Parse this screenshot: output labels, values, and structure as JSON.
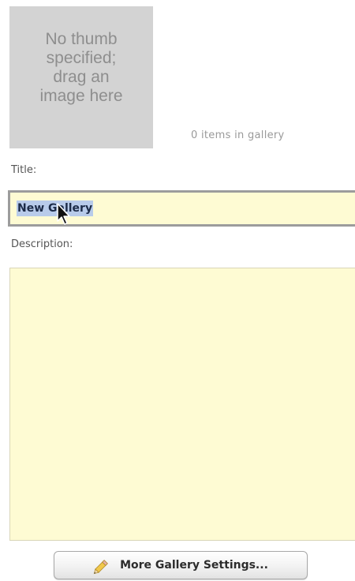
{
  "thumbnail": {
    "placeholder_text": "No thumb\nspecified;\ndrag an\nimage here"
  },
  "gallery": {
    "item_count_text": "0 items in gallery"
  },
  "form": {
    "title_label": "Title:",
    "title_value": "New Gallery",
    "description_label": "Description:",
    "description_value": ""
  },
  "buttons": {
    "more_settings_label": "More Gallery Settings...",
    "more_settings_icon": "pencil-icon"
  },
  "colors": {
    "field_background": "#fefbd3",
    "selection_highlight": "#b8cbea",
    "thumb_background": "#d3d3d3"
  }
}
